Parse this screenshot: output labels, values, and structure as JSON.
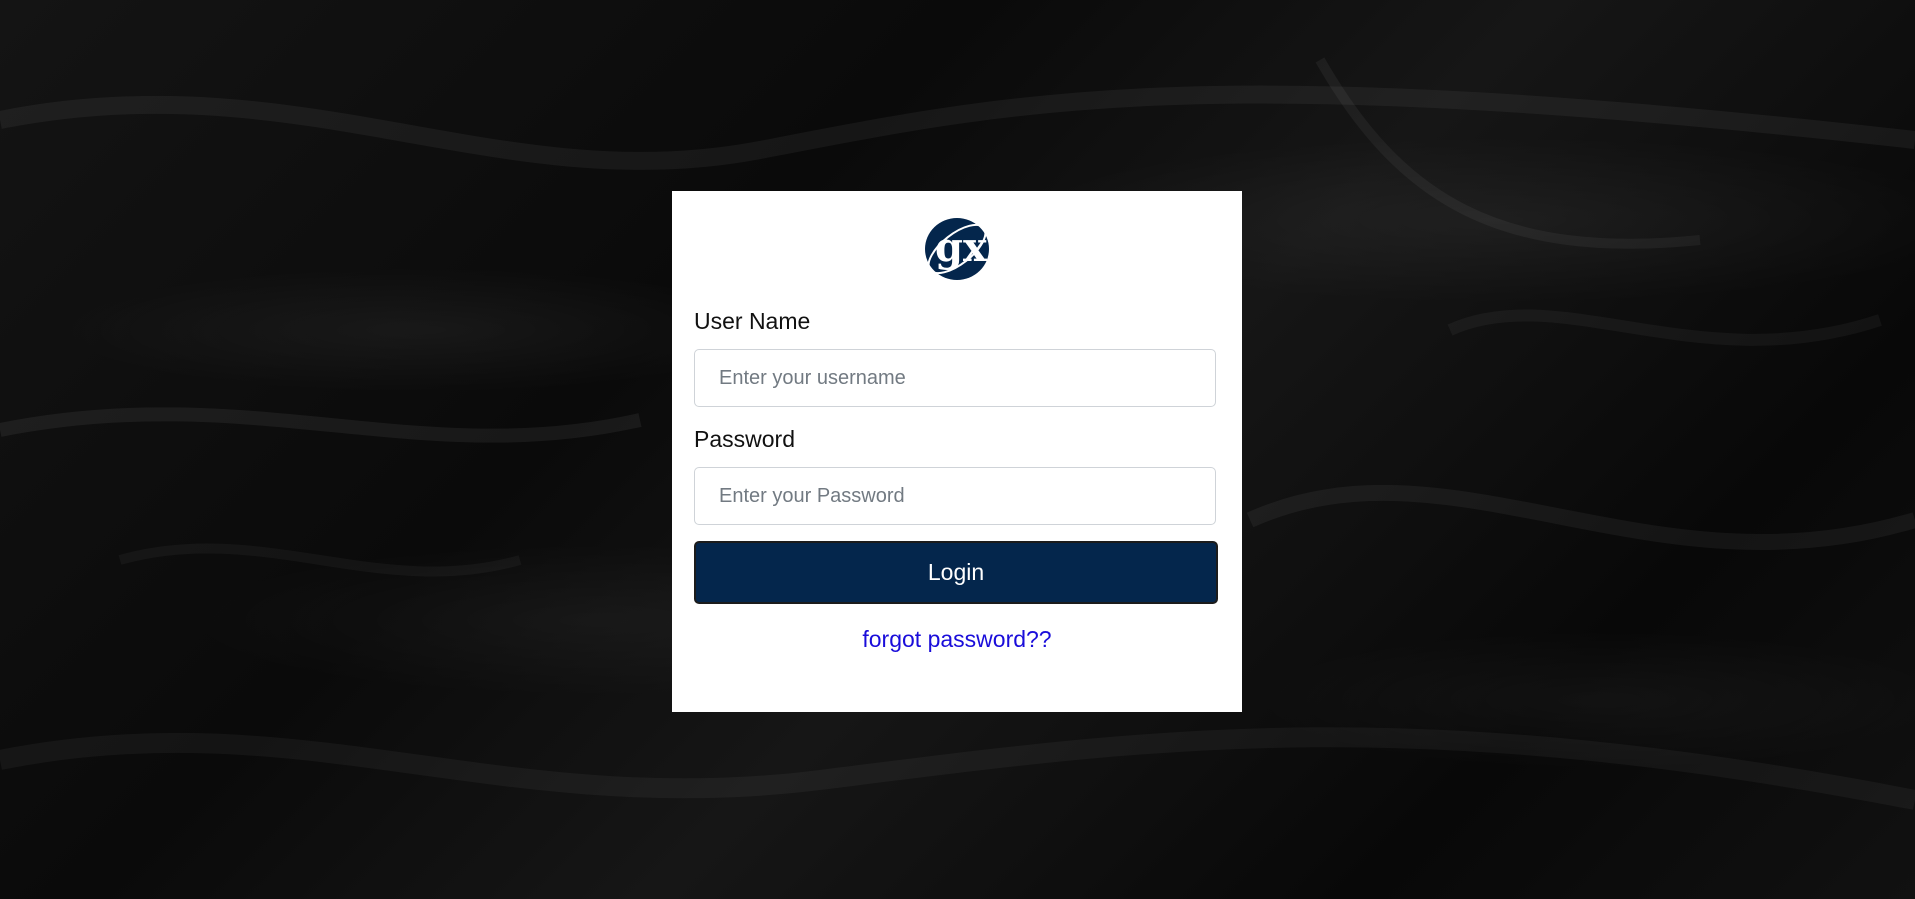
{
  "page": {
    "logo_text": "gx",
    "brand_color": "#04264c"
  },
  "form": {
    "username_label": "User Name",
    "username_placeholder": "Enter your username",
    "username_value": "",
    "password_label": "Password",
    "password_placeholder": "Enter your Password",
    "password_value": "",
    "login_label": "Login",
    "forgot_label": "forgot password??"
  },
  "icons": {
    "logo": "gx-globe-logo-icon"
  }
}
